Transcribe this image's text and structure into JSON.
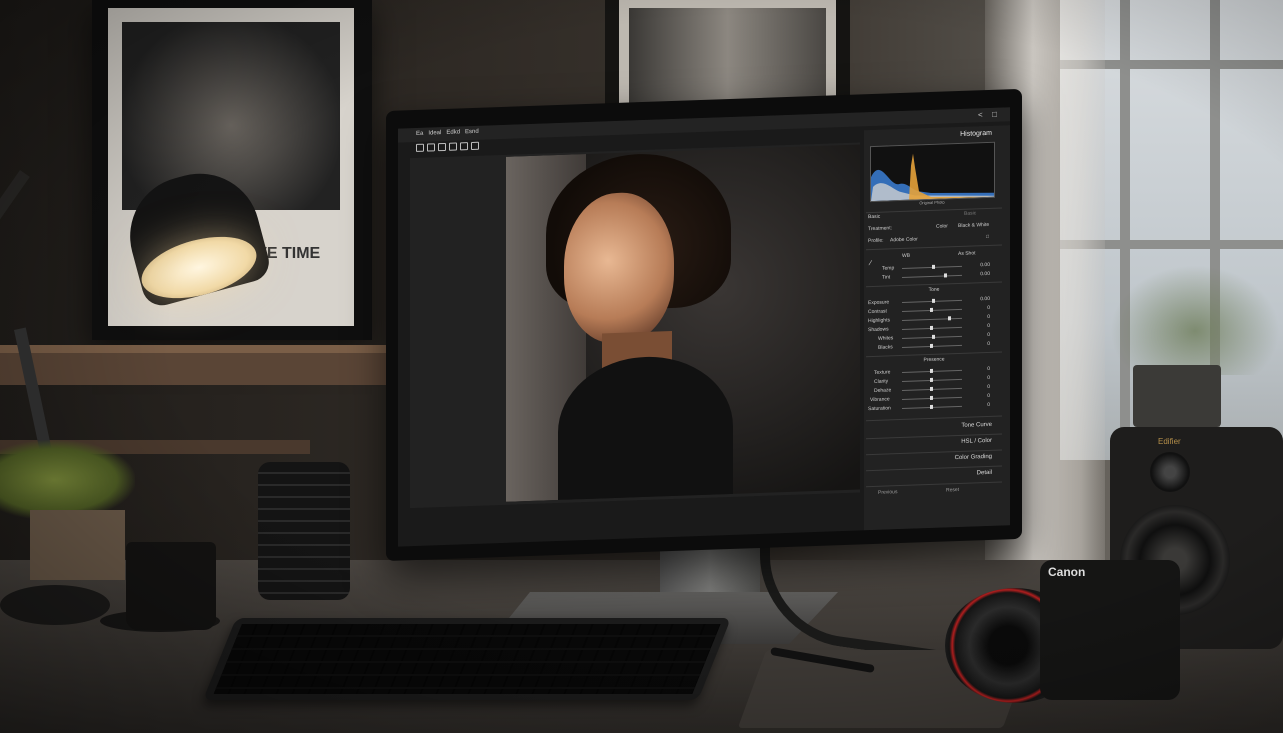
{
  "wall_art": {
    "caption": "FIVE TIME"
  },
  "speaker": {
    "brand": "Edifier"
  },
  "camera": {
    "brand": "Canon"
  },
  "app": {
    "menu": [
      "Ea",
      "Ideal",
      "Edkd",
      "Esnd"
    ],
    "panel_title": "Histogram",
    "histogram": {
      "left": "",
      "center": "Original Photo",
      "right": ""
    },
    "basic": {
      "header": "Basic",
      "preset_label": "Basic",
      "treatment_label": "Treatment:",
      "treatment_color": "Color",
      "treatment_bw": "Black & White",
      "profile_label": "Profile:",
      "profile_value": "Adobe Color",
      "wb_label": "WB",
      "wb_value": "As Shot",
      "temp_label": "Temp",
      "temp_value": "0.00",
      "tint_label": "Tint",
      "tint_value": "0.00",
      "tone_header": "Tone",
      "exposure_label": "Exposure",
      "exposure_value": "0.00",
      "contrast_label": "Contrast",
      "contrast_value": "0",
      "highlights_label": "Highlights",
      "highlights_value": "0",
      "shadows_label": "Shadows",
      "shadows_value": "0",
      "whites_label": "Whites",
      "whites_value": "0",
      "blacks_label": "Blacks",
      "blacks_value": "0",
      "presence_header": "Presence",
      "texture_label": "Texture",
      "texture_value": "0",
      "clarity_label": "Clarity",
      "clarity_value": "0",
      "dehaze_label": "Dehaze",
      "dehaze_value": "0",
      "vibrance_label": "Vibrance",
      "vibrance_value": "0",
      "saturation_label": "Saturation",
      "saturation_value": "0"
    },
    "collapsed_sections": [
      "Tone Curve",
      "HSL / Color",
      "Color Grading",
      "Detail"
    ],
    "bottom_buttons": [
      "Previous",
      "Reset"
    ]
  }
}
